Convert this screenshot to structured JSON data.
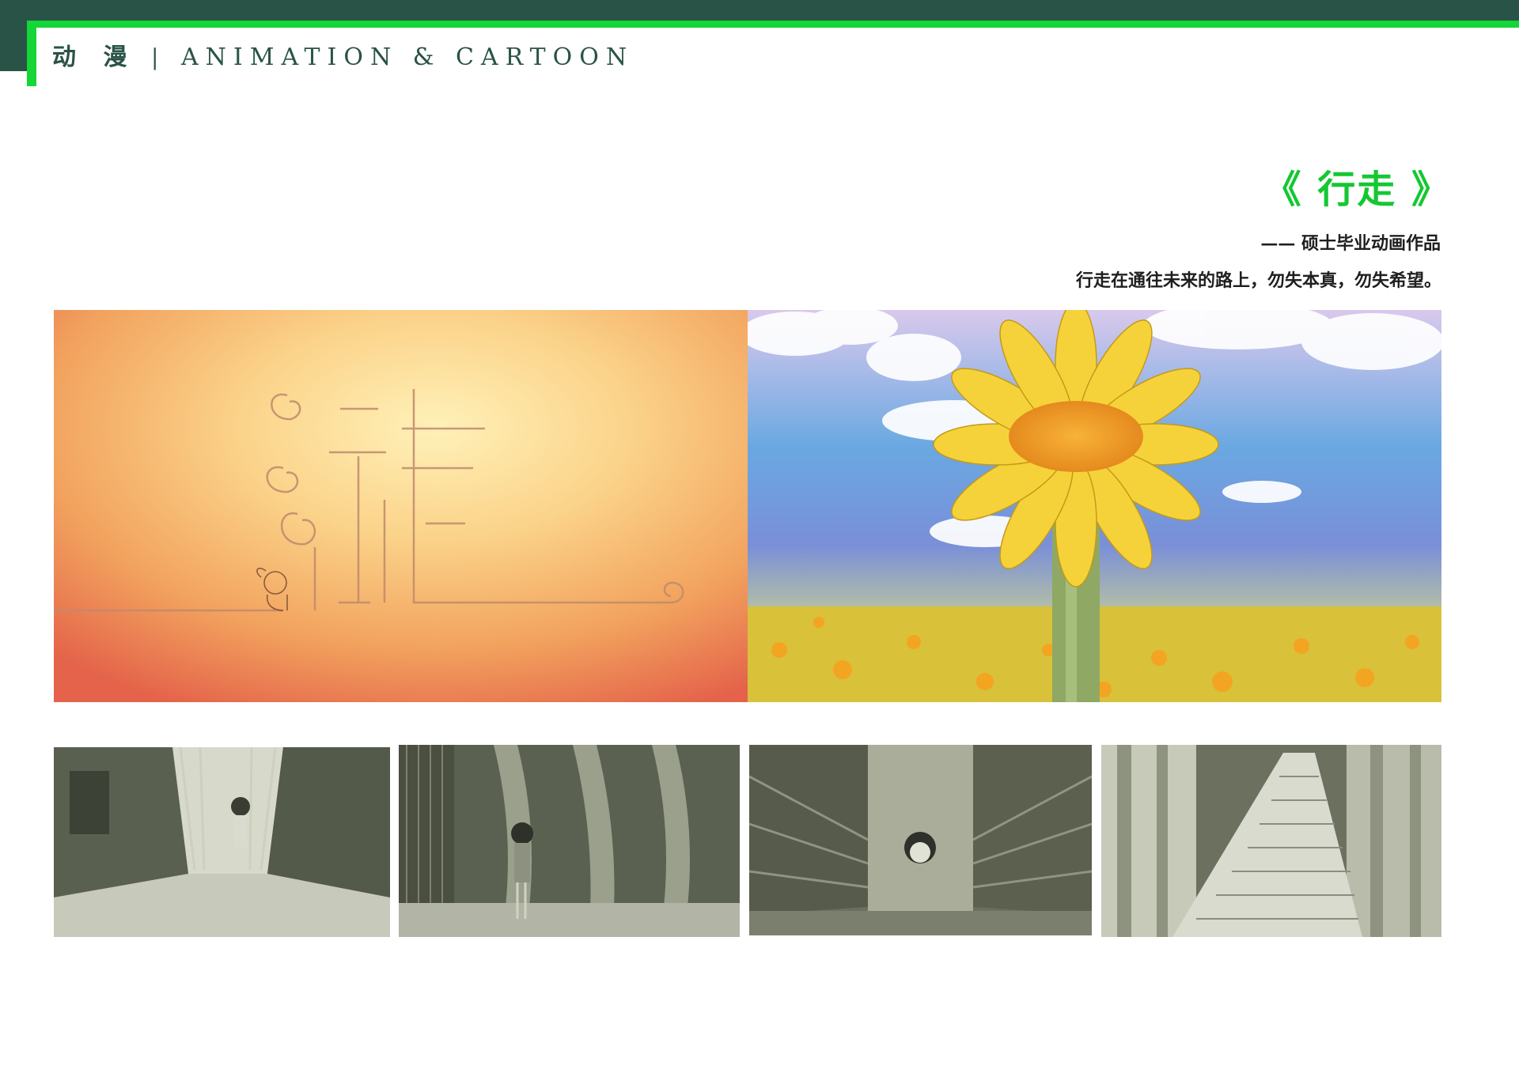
{
  "header": {
    "section_cn": "动 漫",
    "separator": "|",
    "section_en": "ANIMATION & CARTOON"
  },
  "work": {
    "title": "《 行走 》",
    "subtitle": "—— 硕士毕业动画作品",
    "tagline": "行走在通往未来的路上，勿失本真，勿失希望。"
  },
  "colors": {
    "brand_dark": "#2a5347",
    "brand_green": "#14d636",
    "title_green": "#14c832"
  },
  "images": [
    {
      "id": "hero-left",
      "depicts": "orange-title-card-with-walking-child"
    },
    {
      "id": "hero-right",
      "depicts": "giant-sunflower-over-sunflower-field"
    },
    {
      "id": "thumb-1",
      "depicts": "girl-walking-in-book-corridor"
    },
    {
      "id": "thumb-2",
      "depicts": "girl-standing-among-book-pages"
    },
    {
      "id": "thumb-3",
      "depicts": "face-inside-book-spine-tunnel"
    },
    {
      "id": "thumb-4",
      "depicts": "staircase-of-letters-between-pages"
    }
  ]
}
